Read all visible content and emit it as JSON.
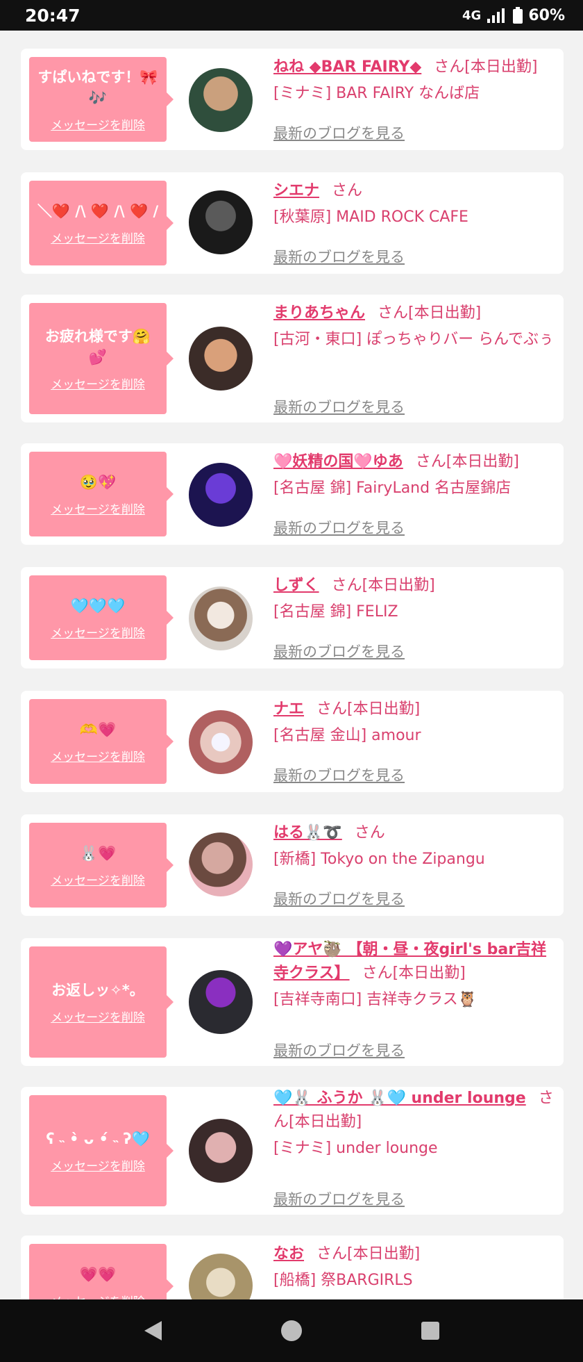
{
  "status": {
    "time": "20:47",
    "network": "4G",
    "battery": "60%"
  },
  "feed": {
    "delete_label": "メッセージを削除",
    "blog_label": "最新のブログを見る",
    "items": [
      {
        "message": "すぱいねです！🎀🎶",
        "name": "ねね ◆BAR FAIRY◆",
        "suffix": "さん[本日出勤]",
        "shop": "[ミナミ] BAR FAIRY なんば店",
        "avatar_colors": [
          "#2f4e3c",
          "#caa07d"
        ]
      },
      {
        "message": "＼❤️ /\\ ❤️ /\\ ❤️ /",
        "name": "シエナ",
        "suffix": "さん",
        "shop": "[秋葉原] MAID ROCK CAFE",
        "avatar_colors": [
          "#1a1a1a",
          "#5a5a5a"
        ]
      },
      {
        "message": "お疲れ様です🤗💕",
        "name": "まりあちゃん",
        "suffix": "さん[本日出勤]",
        "shop": "[古河・東口] ぽっちゃりバー らんでぶぅ",
        "avatar_colors": [
          "#3b2c28",
          "#d9a07a"
        ]
      },
      {
        "message": "🥹💖",
        "name": "🩷妖精の国🩷ゆあ",
        "suffix": "さん[本日出勤]",
        "shop": "[名古屋 錦] FairyLand 名古屋錦店",
        "avatar_colors": [
          "#1c1450",
          "#6a3cd6"
        ]
      },
      {
        "message": "🩵🩵🩵",
        "name": "しずく",
        "suffix": "さん[本日出勤]",
        "shop": "[名古屋 錦] FELIZ",
        "avatar_colors": [
          "#d8d2cc",
          "#8a6a55"
        ]
      },
      {
        "message": "🫶💗",
        "name": "ナエ",
        "suffix": "さん[本日出勤]",
        "shop": "[名古屋 金山] amour",
        "avatar_colors": [
          "#e8c8c0",
          "#b06060"
        ]
      },
      {
        "message": "🐰💗",
        "name": "はる🐰➰",
        "suffix": "さん",
        "shop": "[新橋] Tokyo on the Zipangu",
        "avatar_colors": [
          "#d5a8a0",
          "#6b4a40"
        ]
      },
      {
        "message": "お返しッ✧*。",
        "name": "💜アヤ🦥 【朝・昼・夜girl's bar吉祥寺クラス】",
        "suffix": "さん[本日出勤]",
        "shop": "[吉祥寺南口] 吉祥寺クラス🦉",
        "avatar_colors": [
          "#2a2a30",
          "#8a2fc0"
        ]
      },
      {
        "message": "ʕ ˵ •̀ ᴗ •́ ˵ ʔ🩵",
        "name": "🩵🐰 ふうか 🐰🩵 under lounge",
        "suffix": "さん[本日出勤]",
        "shop": "[ミナミ] under lounge",
        "avatar_colors": [
          "#3a2a2a",
          "#e0b0b0"
        ]
      },
      {
        "message": "💗💗",
        "name": "なお",
        "suffix": "さん[本日出勤]",
        "shop": "[船橋] 祭BARGIRLS",
        "avatar_colors": [
          "#d9c8a8",
          "#a8946a"
        ]
      }
    ]
  }
}
